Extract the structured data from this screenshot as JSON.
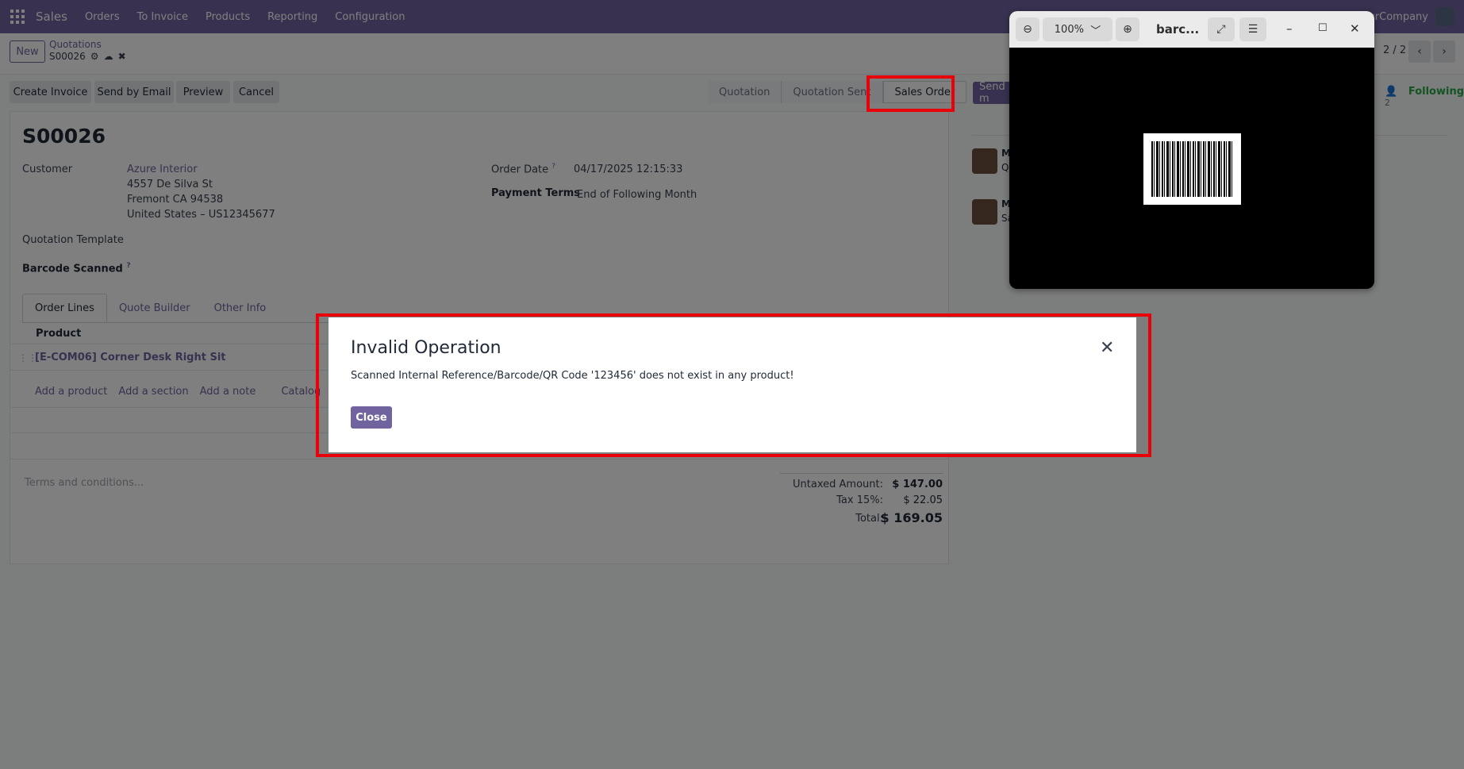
{
  "navbar": {
    "brand": "Sales",
    "menu": [
      "Orders",
      "To Invoice",
      "Products",
      "Reporting",
      "Configuration"
    ],
    "company": "ourCompany"
  },
  "control_panel": {
    "new_label": "New",
    "breadcrumb_parent": "Quotations",
    "breadcrumb_current": "S00026",
    "pager": "2 / 2"
  },
  "actions": {
    "create_invoice": "Create Invoice",
    "send_by_email": "Send by Email",
    "preview": "Preview",
    "cancel": "Cancel"
  },
  "statusbar": [
    "Quotation",
    "Quotation Sent",
    "Sales Order"
  ],
  "chatter": {
    "send_message": "Send m",
    "follower_count": "2",
    "following": "Following",
    "messages": [
      {
        "author": "M",
        "preview": "Q"
      },
      {
        "author": "M",
        "preview": "Sa"
      }
    ]
  },
  "form": {
    "title": "S00026",
    "customer_label": "Customer",
    "customer_name": "Azure Interior",
    "address": [
      "4557 De Silva St",
      "Fremont CA 94538",
      "United States – US12345677"
    ],
    "order_date_label": "Order Date",
    "order_date": "04/17/2025 12:15:33",
    "payment_terms_label": "Payment Terms",
    "payment_terms": "End of Following Month",
    "quotation_template_label": "Quotation Template",
    "barcode_scanned_label": "Barcode Scanned",
    "help_mark": "?"
  },
  "tabs": [
    "Order Lines",
    "Quote Builder",
    "Other Info"
  ],
  "order_lines": {
    "column_product": "Product",
    "rows": [
      {
        "product": "[E-COM06] Corner Desk Right Sit"
      }
    ],
    "add_product": "Add a product",
    "add_section": "Add a section",
    "add_note": "Add a note",
    "catalog": "Catalog"
  },
  "terms_placeholder": "Terms and conditions...",
  "totals": {
    "untaxed_label": "Untaxed Amount:",
    "untaxed": "$ 147.00",
    "tax_label": "Tax 15%:",
    "tax": "$ 22.05",
    "total_label": "Total:",
    "total": "$ 169.05"
  },
  "modal": {
    "title": "Invalid Operation",
    "message": "Scanned Internal Reference/Barcode/QR Code '123456' does not exist in any product!",
    "close_label": "Close"
  },
  "viewer": {
    "zoom": "100%",
    "title": "barc..."
  }
}
